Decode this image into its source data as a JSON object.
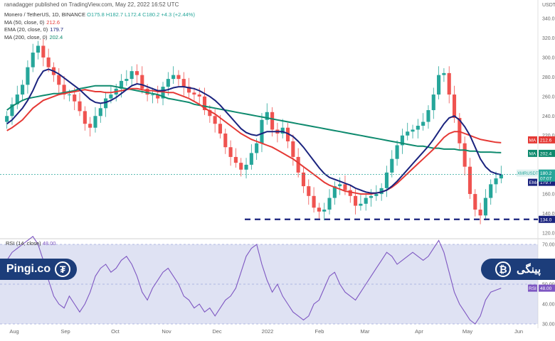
{
  "attribution": "ranadagger published on TradingView.com, May 22, 2022 16:52 UTC",
  "legend": {
    "symbol": "Monero / TetherUS, 1D, BINANCE",
    "ohlc": "O175.8 H182.7 L172.4 C180.2 +4.3 (+2.44%)",
    "ma50": {
      "label": "MA (50, close, 0)",
      "value": "212.6",
      "color": "#e53935"
    },
    "ema20": {
      "label": "EMA (20, close, 0)",
      "value": "179.7",
      "color": "#1a237e"
    },
    "ma200": {
      "label": "MA (200, close, 0)",
      "value": "202.4",
      "color": "#0e8a6e"
    }
  },
  "rsi": {
    "label": "RSI (14, close)",
    "value": "48.00"
  },
  "branding": {
    "left_text": "Pingi.co",
    "right_text": "پینگی",
    "tether_glyph": "₮",
    "btc_glyph": "₿"
  },
  "price_tags": {
    "usdt": "USDT",
    "symbol": "XMRUSDT",
    "last": "180.2",
    "countdown": "07:07",
    "ma50": "212.6",
    "ema20": "179.7",
    "ma200": "202.4",
    "support": "134.0",
    "rsi": "48.00",
    "ma_tag": "MA",
    "ema_tag": "EMA",
    "rsi_tag": "RSI"
  },
  "colors": {
    "up": "#26a69a",
    "down": "#ef5350",
    "ma50": "#e53935",
    "ema20": "#1a237e",
    "ma200": "#0e8a6e",
    "rsi": "#7e57c2",
    "rsi_band": "#c5cae9",
    "support": "#1a237e"
  },
  "chart_data": {
    "type": "candlestick",
    "price_axis": {
      "min": 120,
      "max": 340,
      "ticks": [
        120,
        140,
        160,
        180,
        200,
        220,
        240,
        260,
        280,
        300,
        320,
        340
      ]
    },
    "x_axis_labels": [
      "Aug",
      "Sep",
      "Oct",
      "Nov",
      "Dec",
      "2022",
      "Feb",
      "Mar",
      "Apr",
      "May",
      "Jun"
    ],
    "support_level": 134.0,
    "close_series": [
      240,
      252,
      262,
      272,
      290,
      305,
      312,
      300,
      290,
      282,
      272,
      262,
      262,
      255,
      245,
      232,
      228,
      240,
      248,
      258,
      262,
      268,
      276,
      278,
      286,
      282,
      268,
      262,
      262,
      258,
      270,
      278,
      282,
      278,
      270,
      264,
      262,
      260,
      246,
      240,
      232,
      222,
      208,
      198,
      192,
      185,
      190,
      202,
      212,
      236,
      244,
      226,
      222,
      228,
      214,
      198,
      182,
      168,
      158,
      146,
      142,
      144,
      156,
      168,
      170,
      164,
      158,
      148,
      150,
      156,
      158,
      160,
      166,
      182,
      196,
      210,
      220,
      224,
      226,
      230,
      234,
      246,
      262,
      282,
      284,
      262,
      238,
      212,
      188,
      160,
      144,
      138,
      156,
      170,
      176,
      180
    ],
    "ma200_series": [
      246,
      250,
      253,
      256,
      258,
      259,
      260,
      261,
      262,
      263,
      263,
      264,
      265,
      266,
      268,
      269,
      270,
      271,
      271,
      271,
      271,
      270,
      269,
      268,
      267,
      266,
      265,
      264,
      263,
      262,
      260,
      258,
      257,
      256,
      255,
      254,
      252,
      251,
      250,
      249,
      248,
      247,
      246,
      245,
      244,
      243,
      242,
      241,
      240,
      239,
      238,
      237,
      236,
      235,
      234,
      233,
      232,
      231,
      230,
      229,
      228,
      227,
      226,
      225,
      224,
      223,
      222,
      221,
      220,
      219,
      218,
      217,
      216,
      215,
      214,
      213,
      212,
      211,
      210,
      209,
      209,
      208,
      207,
      207,
      206,
      206,
      206,
      205,
      205,
      204,
      204,
      203,
      203,
      203,
      202.6,
      202.4
    ],
    "ma50_series": [
      225,
      228,
      232,
      236,
      242,
      248,
      252,
      256,
      258,
      260,
      262,
      263,
      264,
      265,
      266,
      267,
      266,
      265,
      265,
      264,
      264,
      265,
      266,
      267,
      268,
      268,
      267,
      266,
      266,
      265,
      265,
      264,
      264,
      262,
      260,
      258,
      255,
      252,
      248,
      245,
      242,
      238,
      234,
      230,
      226,
      222,
      219,
      216,
      214,
      212,
      210,
      208,
      205,
      202,
      199,
      196,
      192,
      188,
      184,
      180,
      176,
      172,
      169,
      167,
      165,
      163,
      162,
      161,
      160,
      160,
      160,
      161,
      162,
      164,
      167,
      171,
      176,
      181,
      186,
      191,
      196,
      201,
      206,
      212,
      218,
      222,
      224,
      224,
      222,
      220,
      218,
      216,
      215,
      214,
      213,
      212.6
    ],
    "ema20_series": [
      232,
      236,
      242,
      248,
      256,
      266,
      278,
      286,
      288,
      286,
      283,
      279,
      275,
      271,
      267,
      262,
      257,
      254,
      253,
      254,
      256,
      259,
      263,
      267,
      271,
      273,
      272,
      270,
      268,
      266,
      266,
      267,
      269,
      270,
      270,
      269,
      268,
      266,
      263,
      260,
      256,
      251,
      245,
      239,
      233,
      227,
      223,
      221,
      220,
      222,
      224,
      224,
      224,
      224,
      222,
      219,
      214,
      208,
      201,
      194,
      187,
      181,
      177,
      175,
      173,
      171,
      169,
      166,
      164,
      162,
      161,
      161,
      162,
      164,
      168,
      173,
      179,
      185,
      191,
      197,
      203,
      209,
      216,
      224,
      232,
      238,
      240,
      236,
      229,
      220,
      208,
      196,
      188,
      183,
      181,
      179.7
    ],
    "rsi_axis": {
      "min": 30,
      "max": 70,
      "ticks": [
        30,
        40,
        50,
        60,
        70
      ]
    },
    "rsi_series": [
      62,
      66,
      68,
      70,
      72,
      74,
      70,
      62,
      52,
      44,
      40,
      38,
      44,
      40,
      36,
      40,
      46,
      54,
      58,
      60,
      56,
      58,
      62,
      64,
      60,
      54,
      46,
      42,
      48,
      52,
      56,
      58,
      54,
      50,
      44,
      42,
      38,
      40,
      36,
      38,
      34,
      38,
      42,
      44,
      48,
      56,
      64,
      68,
      70,
      60,
      52,
      46,
      50,
      44,
      40,
      36,
      34,
      32,
      34,
      40,
      42,
      48,
      54,
      56,
      50,
      46,
      44,
      42,
      46,
      50,
      54,
      58,
      62,
      66,
      64,
      60,
      62,
      64,
      66,
      64,
      62,
      64,
      68,
      72,
      66,
      56,
      46,
      40,
      36,
      32,
      30,
      34,
      42,
      46,
      47,
      48
    ]
  }
}
